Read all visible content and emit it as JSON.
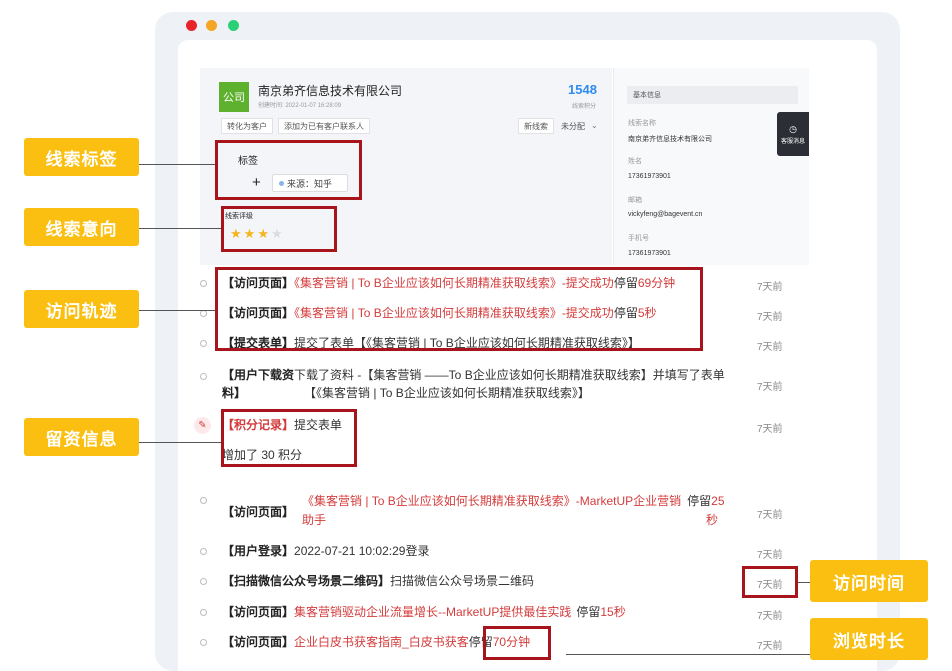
{
  "window": {
    "colors": {
      "close": "#e8232a",
      "minimize": "#f4a521",
      "maximize": "#2bd076"
    }
  },
  "company": {
    "logo_text": "公司",
    "name": "南京弟齐信息技术有限公司",
    "create_time": "创建时间: 2022-01-07 16:28:09",
    "score": "1548",
    "score_label": "线索积分"
  },
  "actions": {
    "convert": "转化为客户",
    "add_contact": "添加为已有客户联系人",
    "new_lead": "新线索",
    "status": "未分配"
  },
  "tags": {
    "title": "标签",
    "add_symbol": "+",
    "source": "来源：知乎"
  },
  "rating": {
    "title": "线索评级",
    "stars": 3,
    "max": 4
  },
  "info": {
    "header": "基本信息",
    "fields": [
      {
        "label": "线索名称",
        "value": "南京弟齐信息技术有限公司"
      },
      {
        "label": "姓名",
        "value": "17361973901"
      },
      {
        "label": "邮箱",
        "value": "vickyfeng@bagevent.cn"
      },
      {
        "label": "手机号",
        "value": "17361973901"
      }
    ]
  },
  "service": {
    "label": "客服消息"
  },
  "timeline": [
    {
      "tag": "【访问页面】",
      "link": "《集客营销 | To B企业应该如何长期精准获取线索》-提交成功",
      "text": "停留",
      "stay": "69分钟",
      "time": "7天前"
    },
    {
      "tag": "【访问页面】",
      "link": "《集客营销 | To B企业应该如何长期精准获取线索》-提交成功",
      "text": "停留",
      "stay": "5秒",
      "time": "7天前"
    },
    {
      "tag": "【提交表单】",
      "text": "提交了表单【《集客营销 | To B企业应该如何长期精准获取线索》】",
      "time": "7天前"
    },
    {
      "tag": "【用户下载资",
      "tag2": "料】",
      "text": "下载了资料 -【集客营销 ——To B企业应该如何长期精准获取线索】并填写了表单",
      "text2": "【《集客营销 | To B企业应该如何长期精准获取线索》】",
      "time": "7天前"
    },
    {
      "tag": "【积分记录】",
      "text": "提交表单",
      "text2": "增加了 30 积分",
      "time": "7天前"
    },
    {
      "tag": "【访问页面】",
      "link": "《集客营销 | To B企业应该如何长期精准获取线索》-MarketUP企业营销",
      "link2": "助手",
      "text": "停留",
      "stay": "25",
      "stay2": "秒",
      "time": "7天前"
    },
    {
      "tag": "【用户登录】",
      "text": "2022-07-21 10:02:29登录",
      "time": "7天前"
    },
    {
      "tag": "【扫描微信公众号场景二维码】",
      "text": "扫描微信公众号场景二维码",
      "time": "7天前"
    },
    {
      "tag": "【访问页面】",
      "link": "集客营销驱动企业流量增长--MarketUP提供最佳实践",
      "text": "停留",
      "stay": "15秒",
      "time": "7天前"
    },
    {
      "tag": "【访问页面】",
      "link": "企业白皮书获客指南_白皮书获客",
      "text": "停留",
      "stay": "70分钟",
      "time": "7天前"
    }
  ],
  "callouts": {
    "lead_tags": "线索标签",
    "lead_intent": "线索意向",
    "visit_track": "访问轨迹",
    "lead_info": "留资信息",
    "visit_time": "访问时间",
    "browse_duration": "浏览时长",
    "color": "#fabf10",
    "box_color": "#a8141c"
  }
}
